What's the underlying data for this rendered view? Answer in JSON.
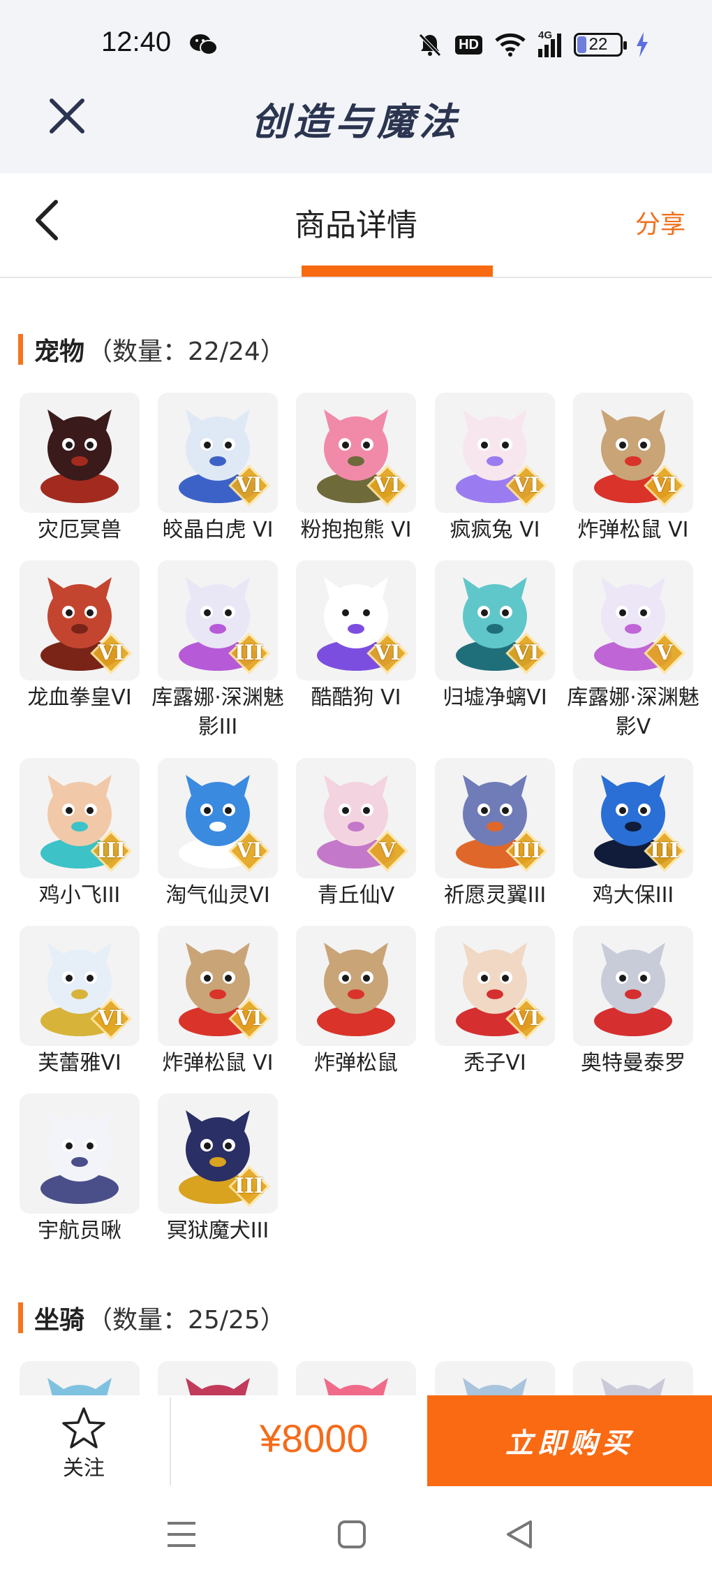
{
  "status_bar": {
    "time": "12:40",
    "network": "4G",
    "hd": "HD",
    "battery": "22",
    "battery_level": 0.22
  },
  "app_header": {
    "title": "创造与魔法"
  },
  "nav": {
    "title": "商品详情",
    "share": "分享"
  },
  "sections": [
    {
      "title": "宠物",
      "count": "（数量：22/24）",
      "items": [
        {
          "name": "灾厄冥兽",
          "rank": "",
          "palette": [
            "#3a1a1a",
            "#a32a1e"
          ]
        },
        {
          "name": "皎晶白虎 VI",
          "rank": "VI",
          "palette": [
            "#dfe8f5",
            "#3d62c7"
          ]
        },
        {
          "name": "粉抱抱熊 VI",
          "rank": "VI",
          "palette": [
            "#f08aa8",
            "#6e6a3a"
          ]
        },
        {
          "name": "疯疯兔 VI",
          "rank": "VI",
          "palette": [
            "#f8e6ee",
            "#9a7cf0"
          ]
        },
        {
          "name": "炸弹松鼠 VI",
          "rank": "VI",
          "palette": [
            "#c9a477",
            "#d9332a"
          ]
        },
        {
          "name": "龙血拳皇VI",
          "rank": "VI",
          "palette": [
            "#c4452f",
            "#7a2418"
          ]
        },
        {
          "name": "库露娜·深渊魅影III",
          "rank": "III",
          "palette": [
            "#e9e6f6",
            "#b65ad8"
          ]
        },
        {
          "name": "酷酷狗 VI",
          "rank": "VI",
          "palette": [
            "#ffffff",
            "#7c4ee0"
          ]
        },
        {
          "name": "归墟净螭VI",
          "rank": "VI",
          "palette": [
            "#5fc7c9",
            "#1f6f7a"
          ]
        },
        {
          "name": "库露娜·深渊魅影V",
          "rank": "V",
          "palette": [
            "#ece6f7",
            "#c065d6"
          ]
        },
        {
          "name": "鸡小飞III",
          "rank": "III",
          "palette": [
            "#f1c9a8",
            "#3cc2c7"
          ]
        },
        {
          "name": "淘气仙灵VI",
          "rank": "VI",
          "palette": [
            "#3a8ae0",
            "#ffffff"
          ]
        },
        {
          "name": "青丘仙V",
          "rank": "V",
          "palette": [
            "#f4d3e0",
            "#c478c9"
          ]
        },
        {
          "name": "祈愿灵翼III",
          "rank": "III",
          "palette": [
            "#6f7cb8",
            "#e0672a"
          ]
        },
        {
          "name": "鸡大保III",
          "rank": "III",
          "palette": [
            "#2a6fd6",
            "#101c3a"
          ]
        },
        {
          "name": "芙蕾雅VI",
          "rank": "VI",
          "palette": [
            "#e6eef8",
            "#d8b33a"
          ]
        },
        {
          "name": "炸弹松鼠 VI",
          "rank": "VI",
          "palette": [
            "#c9a477",
            "#d9332a"
          ]
        },
        {
          "name": "炸弹松鼠",
          "rank": "",
          "palette": [
            "#c9a477",
            "#d9332a"
          ]
        },
        {
          "name": "秃子VI",
          "rank": "VI",
          "palette": [
            "#f0d8c4",
            "#d62f2f"
          ]
        },
        {
          "name": "奥特曼泰罗",
          "rank": "",
          "palette": [
            "#c7ccd8",
            "#d62f2f"
          ]
        },
        {
          "name": "宇航员啾",
          "rank": "",
          "palette": [
            "#f3f3fa",
            "#4a4f8a"
          ]
        },
        {
          "name": "冥狱魔犬III",
          "rank": "III",
          "palette": [
            "#2a2f66",
            "#d9a21f"
          ]
        }
      ]
    },
    {
      "title": "坐骑",
      "count": "（数量：25/25）",
      "items": [
        {
          "palette": [
            "#7fc2e0",
            "#ffffff"
          ]
        },
        {
          "palette": [
            "#c23a5a",
            "#f0e0d0"
          ]
        },
        {
          "palette": [
            "#f06a8a",
            "#f6c24a"
          ]
        },
        {
          "palette": [
            "#a9c4dd",
            "#ffffff"
          ]
        },
        {
          "palette": [
            "#c9c9d8",
            "#ffffff"
          ]
        }
      ]
    }
  ],
  "bottom_bar": {
    "follow": "关注",
    "price": "¥8000",
    "buy": "立即购买"
  },
  "colors": {
    "accent": "#f86a12",
    "header_bg": "#f2f4f8",
    "title": "#2b3550"
  }
}
